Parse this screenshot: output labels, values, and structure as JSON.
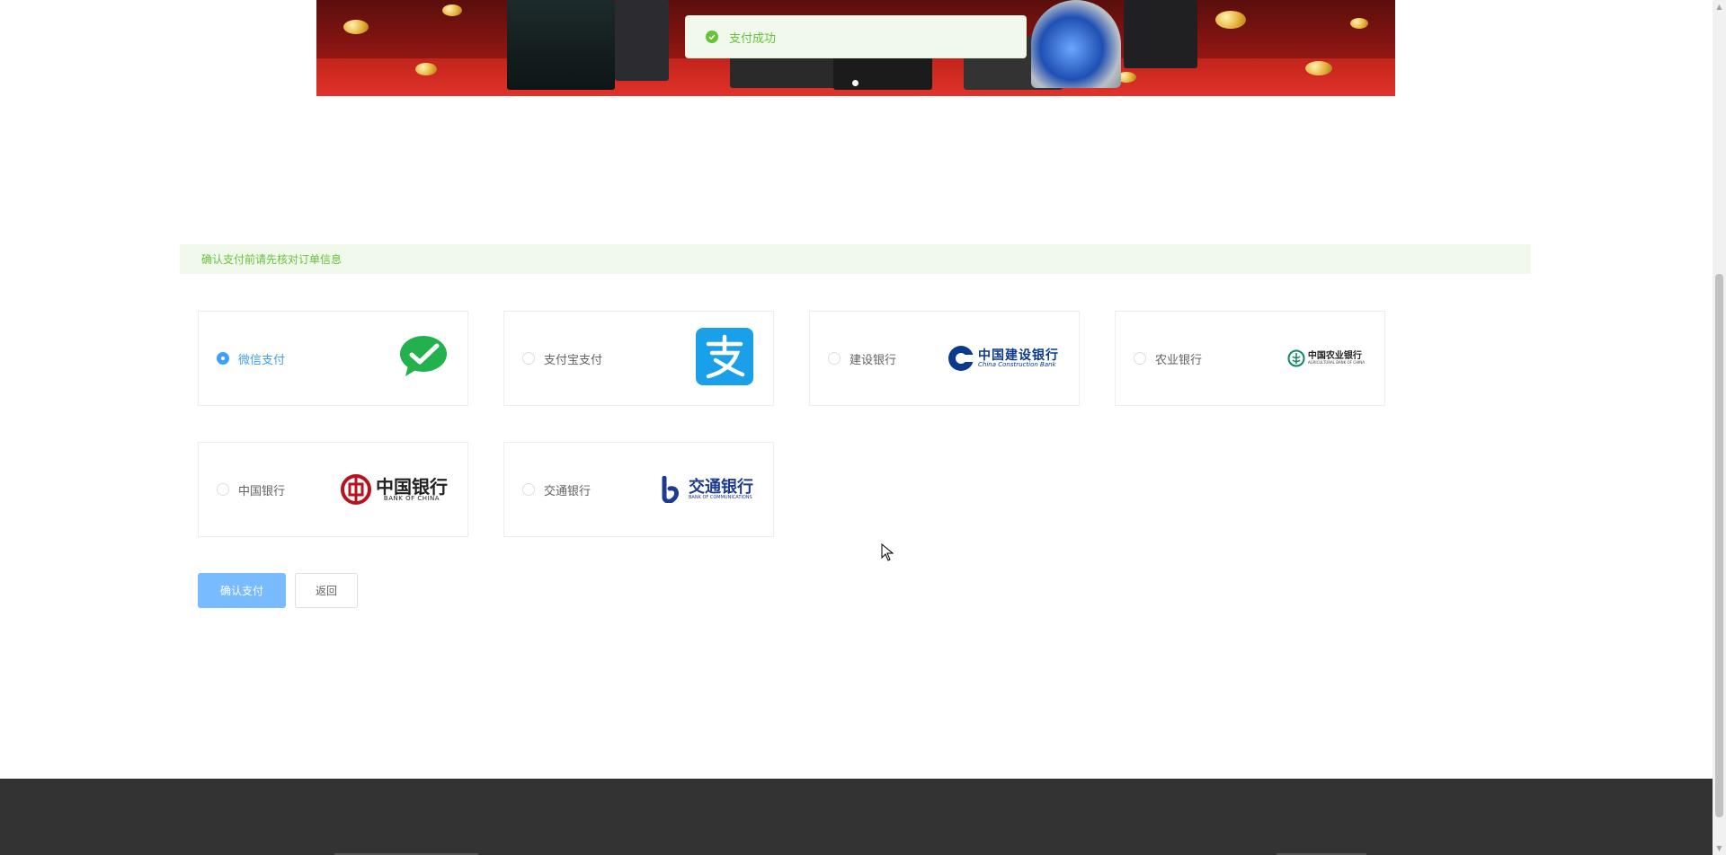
{
  "toast": {
    "message": "支付成功",
    "icon": "success-check-icon"
  },
  "alert": {
    "text": "确认支付前请先核对订单信息"
  },
  "payment_methods": [
    {
      "label": "微信支付",
      "selected": true,
      "logo": "wechat-pay-logo"
    },
    {
      "label": "支付宝支付",
      "selected": false,
      "logo": "alipay-logo"
    },
    {
      "label": "建设银行",
      "selected": false,
      "logo": "ccb-logo",
      "logo_text": "中国建设银行",
      "logo_sub": "China Construction Bank"
    },
    {
      "label": "农业银行",
      "selected": false,
      "logo": "abc-logo",
      "logo_text": "中国农业银行",
      "logo_sub": "AGRICULTURAL BANK OF CHINA"
    },
    {
      "label": "中国银行",
      "selected": false,
      "logo": "boc-logo",
      "logo_text": "中国银行",
      "logo_sub": "BANK OF CHINA"
    },
    {
      "label": "交通银行",
      "selected": false,
      "logo": "bocom-logo",
      "logo_text": "交通银行",
      "logo_sub": "BANK OF COMMUNICATIONS"
    }
  ],
  "buttons": {
    "confirm": "确认支付",
    "back": "返回"
  },
  "colors": {
    "primary": "#409eff",
    "success": "#67c23a",
    "footer": "#333333"
  }
}
